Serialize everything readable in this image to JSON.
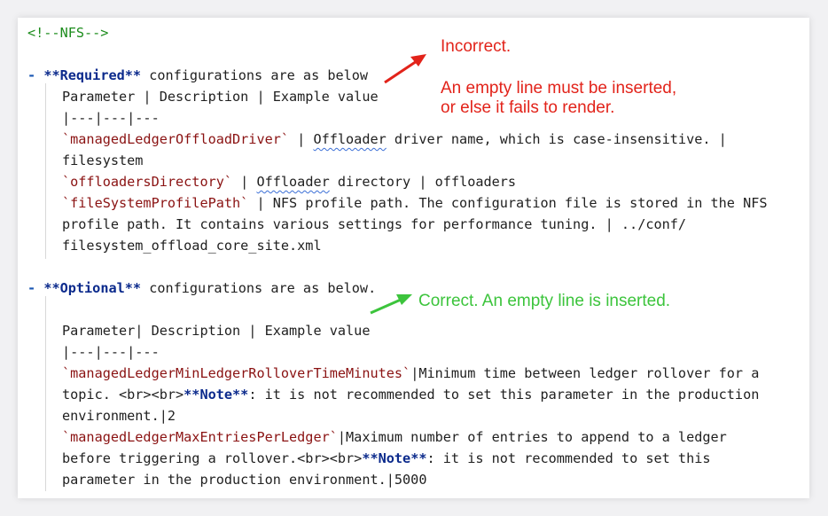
{
  "colors": {
    "comment": "#1c8c1c",
    "keyword_bold": "#0b2a8c",
    "code_span": "#8a1212",
    "annotation_incorrect": "#e2231a",
    "annotation_correct": "#3cc43c"
  },
  "editor": {
    "comment_line": "<!--NFS-->",
    "required": {
      "dash": "-",
      "bold": "**Required**",
      "rest": " configurations are as below",
      "header": "Parameter | Description | Example value",
      "separator": "|---|---|---",
      "row1_code": "`managedLedgerOffloadDriver`",
      "row1_sep": " | ",
      "row1_squig": "Offloader",
      "row1_rest": " driver name, which is case-insensitive. |",
      "row1_wrap": "filesystem",
      "row2_code": "`offloadersDirectory`",
      "row2_sep": " | ",
      "row2_squig": "Offloader",
      "row2_rest": " directory | offloaders",
      "row3_code": "`fileSystemProfilePath`",
      "row3_rest": " | NFS profile path. The configuration file is stored in the NFS",
      "row3_wrap1": "profile path. It contains various settings for performance tuning. | ../conf/",
      "row3_wrap2": "filesystem_offload_core_site.xml"
    },
    "optional": {
      "dash": "-",
      "bold": "**Optional**",
      "rest": " configurations are as below.",
      "header": "Parameter| Description | Example value",
      "separator": "|---|---|---",
      "row1_code": "`managedLedgerMinLedgerRolloverTimeMinutes`",
      "row1_rest": "|Minimum time between ledger rollover for a",
      "row1_wrap1_a": "topic. <br><br>",
      "row1_wrap1_bold": "**Note**",
      "row1_wrap1_b": ": it is not recommended to set this parameter in the production",
      "row1_wrap2": "environment.|2",
      "row2_code": "`managedLedgerMaxEntriesPerLedger`",
      "row2_rest": "|Maximum number of entries to append to a ledger",
      "row2_wrap1_a": "before triggering a rollover.<br><br>",
      "row2_wrap1_bold": "**Note**",
      "row2_wrap1_b": ": it is not recommended to set this",
      "row2_wrap2": "parameter in the production environment.|5000"
    }
  },
  "annotations": {
    "incorrect_title": "Incorrect.",
    "incorrect_line1": "An empty line must be inserted,",
    "incorrect_line2": "or else it fails to render.",
    "correct": "Correct. An empty line is inserted."
  }
}
